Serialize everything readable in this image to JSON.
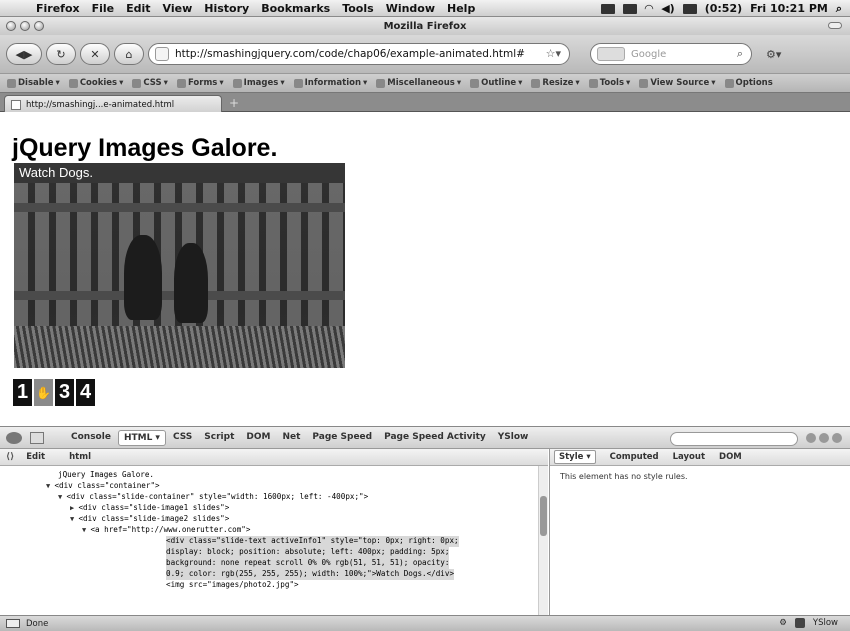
{
  "menubar": {
    "app": "Firefox",
    "items": [
      "File",
      "Edit",
      "View",
      "History",
      "Bookmarks",
      "Tools",
      "Window",
      "Help"
    ],
    "battery": "(0:52)",
    "clock": "Fri 10:21 PM"
  },
  "window": {
    "title": "Mozilla Firefox"
  },
  "navbar": {
    "url": "http://smashingjquery.com/code/chap06/example-animated.html#",
    "search_placeholder": "Google"
  },
  "devbar": {
    "items": [
      "Disable",
      "Cookies",
      "CSS",
      "Forms",
      "Images",
      "Information",
      "Miscellaneous",
      "Outline",
      "Resize",
      "Tools",
      "View Source",
      "Options"
    ]
  },
  "tab": {
    "label": "http://smashingj...e-animated.html"
  },
  "page": {
    "heading": "jQuery Images Galore.",
    "caption": "Watch Dogs.",
    "pager": [
      "1",
      "✋",
      "3",
      "4"
    ]
  },
  "firebug": {
    "tabs": [
      "Console",
      "HTML ▾",
      "CSS",
      "Script",
      "DOM",
      "Net",
      "Page Speed",
      "Page Speed Activity",
      "YSlow"
    ],
    "subbar": {
      "edit": "Edit",
      "crumb": "html"
    },
    "side_tabs": [
      "Style ▾",
      "Computed",
      "Layout",
      "DOM"
    ],
    "side_message": "This element has no style rules.",
    "html_lines": [
      "jQuery Images Galore.",
      "<div class=\"container\">",
      "<div class=\"slide-container\" style=\"width: 1600px; left: -400px;\">",
      "<div class=\"slide-image1 slides\">",
      "<div class=\"slide-image2 slides\">",
      "<a href=\"http://www.onerutter.com\">",
      "<div class=\"slide-text activeInfo1\" style=\"top: 0px; right: 0px;",
      "display: block; position: absolute; left: 400px; padding: 5px;",
      "background: none repeat scroll 0% 0% rgb(51, 51, 51); opacity:",
      "0.9; color: rgb(255, 255, 255); width: 100%;\">Watch Dogs.</div>",
      "<img src=\"images/photo2.jpg\">"
    ]
  },
  "status": {
    "left": "Done",
    "right": "YSlow"
  }
}
